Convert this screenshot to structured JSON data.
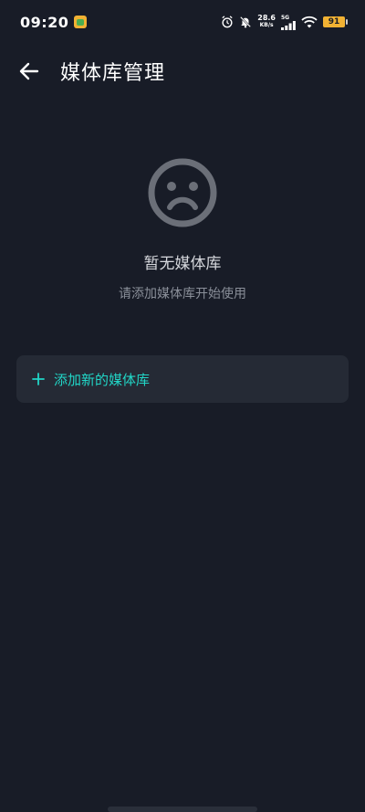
{
  "status_bar": {
    "time": "09:20",
    "net_speed_value": "28.6",
    "net_speed_unit": "KB/s",
    "network_type": "5G",
    "battery_level": "91",
    "icons": [
      "app-badge-icon",
      "alarm-icon",
      "mute-icon",
      "signal-icon",
      "wifi-icon",
      "battery-icon"
    ]
  },
  "header": {
    "title": "媒体库管理",
    "back_icon": "arrow-left-icon"
  },
  "empty_state": {
    "icon": "sad-face-icon",
    "title": "暂无媒体库",
    "subtitle": "请添加媒体库开始使用"
  },
  "add_button": {
    "icon": "plus-icon",
    "label": "添加新的媒体库"
  },
  "colors": {
    "background": "#181c27",
    "card": "#252a35",
    "accent": "#21d6c7",
    "icon_gray": "#6b6f78"
  }
}
